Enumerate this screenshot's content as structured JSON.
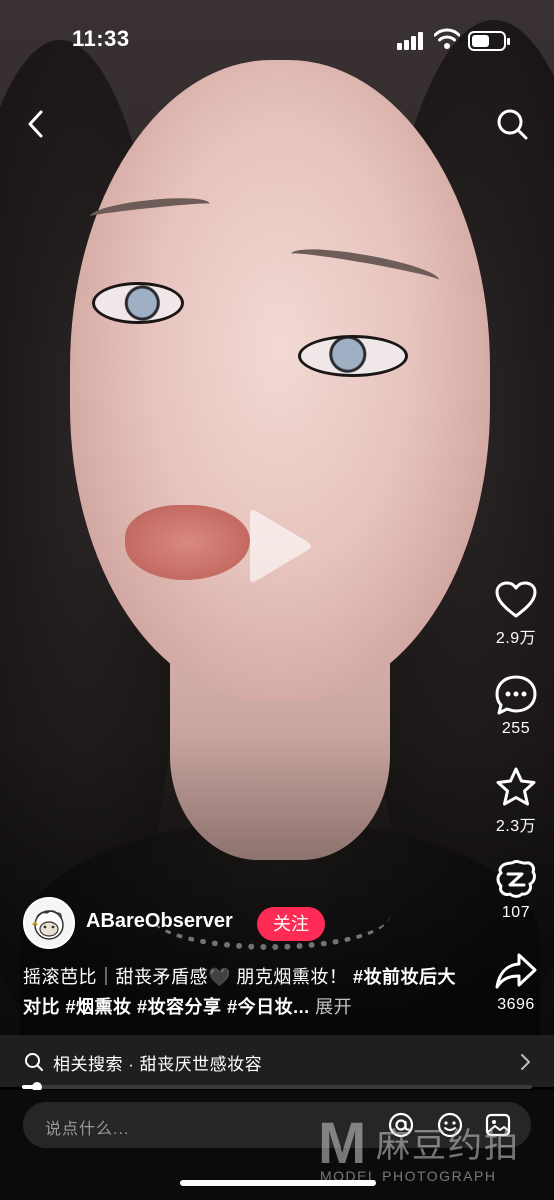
{
  "status_bar": {
    "time": "11:33",
    "battery_level": 0.55
  },
  "nav": {
    "back_icon": "chevron-left-icon",
    "search_icon": "search-icon"
  },
  "video": {
    "play_icon": "play-icon"
  },
  "actions": {
    "like": {
      "icon": "heart-icon",
      "count": "2.9万"
    },
    "comment": {
      "icon": "comment-icon",
      "count": "255"
    },
    "favorite": {
      "icon": "star-icon",
      "count": "2.3万"
    },
    "share_friend": {
      "icon": "quick-share-icon",
      "count": "107"
    },
    "share": {
      "icon": "share-arrow-icon",
      "count": "3696"
    }
  },
  "author": {
    "name": "ABareObserver",
    "follow_label": "关注"
  },
  "caption": {
    "text": "摇滚芭比｜甜丧矛盾感🖤 朋克烟熏妆！",
    "tags": [
      "#妆前妆后大对比",
      "#烟熏妆",
      "#妆容分享",
      "#今日妆..."
    ],
    "more_label": "展开"
  },
  "related_search": {
    "label": "相关搜索 · 甜丧厌世感妆容"
  },
  "progress": {
    "value": 0.03
  },
  "comment": {
    "placeholder": "说点什么..."
  },
  "watermark": {
    "cn": "麻豆约拍",
    "en": "MODEL PHOTOGRAPH",
    "logo": "M"
  },
  "colors": {
    "accent": "#fe2c55",
    "bar_bg": "#1f1f1f"
  }
}
